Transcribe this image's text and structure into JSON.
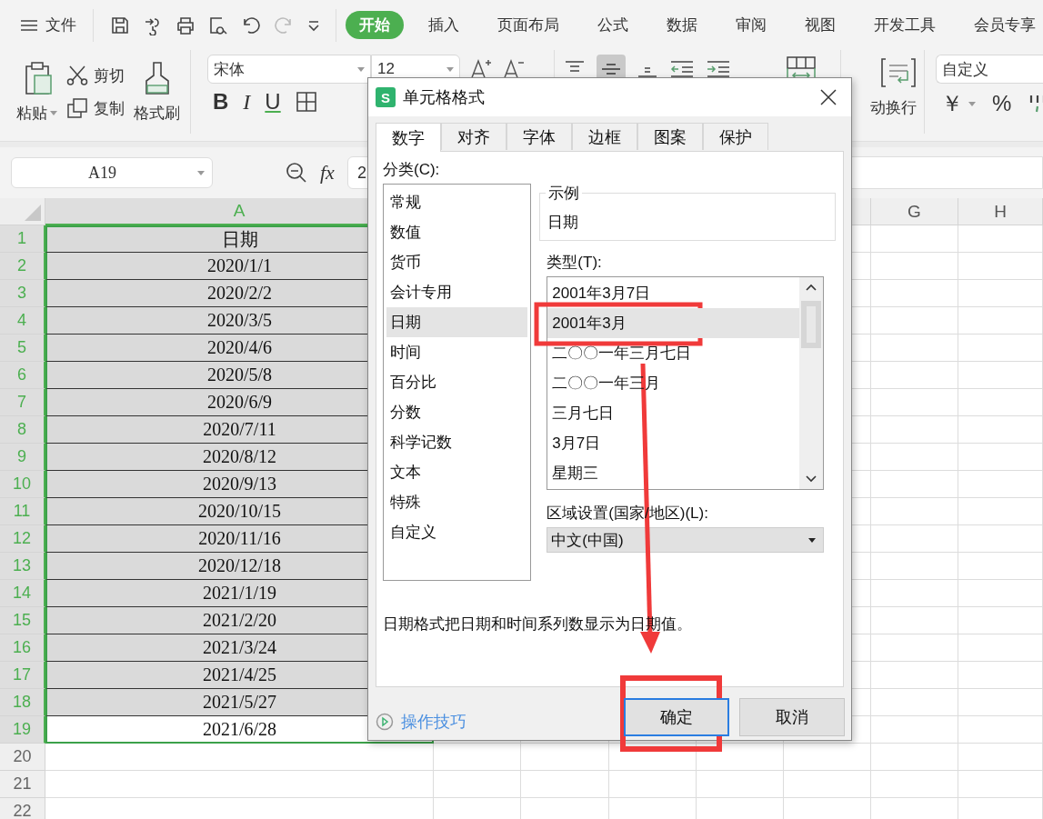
{
  "menu": {
    "file": "文件",
    "tabs": [
      {
        "label": "开始",
        "selected": true
      },
      {
        "label": "插入",
        "selected": false
      },
      {
        "label": "页面布局",
        "selected": false
      },
      {
        "label": "公式",
        "selected": false
      },
      {
        "label": "数据",
        "selected": false
      },
      {
        "label": "审阅",
        "selected": false
      },
      {
        "label": "视图",
        "selected": false
      },
      {
        "label": "开发工具",
        "selected": false
      },
      {
        "label": "会员专享",
        "selected": false
      }
    ]
  },
  "ribbon": {
    "paste": "粘贴",
    "cut": "剪切",
    "copy": "复制",
    "format_painter": "格式刷",
    "font": "宋体",
    "font_size": "12",
    "styles": [
      "B",
      "I",
      "U"
    ],
    "wrap_text": "动换行",
    "number_format": "自定义",
    "currency": "￥",
    "percent": "%"
  },
  "formula_bar": {
    "name_box": "A19",
    "fx": "fx",
    "value": "2"
  },
  "columns": [
    {
      "label": "A",
      "selected": true
    },
    {
      "label": "G",
      "selected": false
    },
    {
      "label": "H",
      "selected": false
    }
  ],
  "rows": [
    {
      "num": "1",
      "value": "日期",
      "selected": true,
      "active": false
    },
    {
      "num": "2",
      "value": "2020/1/1",
      "selected": true,
      "active": false
    },
    {
      "num": "3",
      "value": "2020/2/2",
      "selected": true,
      "active": false
    },
    {
      "num": "4",
      "value": "2020/3/5",
      "selected": true,
      "active": false
    },
    {
      "num": "5",
      "value": "2020/4/6",
      "selected": true,
      "active": false
    },
    {
      "num": "6",
      "value": "2020/5/8",
      "selected": true,
      "active": false
    },
    {
      "num": "7",
      "value": "2020/6/9",
      "selected": true,
      "active": false
    },
    {
      "num": "8",
      "value": "2020/7/11",
      "selected": true,
      "active": false
    },
    {
      "num": "9",
      "value": "2020/8/12",
      "selected": true,
      "active": false
    },
    {
      "num": "10",
      "value": "2020/9/13",
      "selected": true,
      "active": false
    },
    {
      "num": "11",
      "value": "2020/10/15",
      "selected": true,
      "active": false
    },
    {
      "num": "12",
      "value": "2020/11/16",
      "selected": true,
      "active": false
    },
    {
      "num": "13",
      "value": "2020/12/18",
      "selected": true,
      "active": false
    },
    {
      "num": "14",
      "value": "2021/1/19",
      "selected": true,
      "active": false
    },
    {
      "num": "15",
      "value": "2021/2/20",
      "selected": true,
      "active": false
    },
    {
      "num": "16",
      "value": "2021/3/24",
      "selected": true,
      "active": false
    },
    {
      "num": "17",
      "value": "2021/4/25",
      "selected": true,
      "active": false
    },
    {
      "num": "18",
      "value": "2021/5/27",
      "selected": true,
      "active": false
    },
    {
      "num": "19",
      "value": "2021/6/28",
      "selected": true,
      "active": true
    },
    {
      "num": "20",
      "selected": false,
      "active": false
    },
    {
      "num": "21",
      "selected": false,
      "active": false
    },
    {
      "num": "22",
      "selected": false,
      "active": false
    }
  ],
  "dialog": {
    "app_icon": "S",
    "title": "单元格格式",
    "tabs": [
      {
        "label": "数字",
        "selected": true
      },
      {
        "label": "对齐",
        "selected": false
      },
      {
        "label": "字体",
        "selected": false
      },
      {
        "label": "边框",
        "selected": false
      },
      {
        "label": "图案",
        "selected": false
      },
      {
        "label": "保护",
        "selected": false
      }
    ],
    "category_label": "分类(C):",
    "categories": [
      {
        "label": "常规",
        "selected": false
      },
      {
        "label": "数值",
        "selected": false
      },
      {
        "label": "货币",
        "selected": false
      },
      {
        "label": "会计专用",
        "selected": false
      },
      {
        "label": "日期",
        "selected": true
      },
      {
        "label": "时间",
        "selected": false
      },
      {
        "label": "百分比",
        "selected": false
      },
      {
        "label": "分数",
        "selected": false
      },
      {
        "label": "科学记数",
        "selected": false
      },
      {
        "label": "文本",
        "selected": false
      },
      {
        "label": "特殊",
        "selected": false
      },
      {
        "label": "自定义",
        "selected": false
      }
    ],
    "sample": {
      "label": "示例",
      "value": "日期"
    },
    "type_label": "类型(T):",
    "types": [
      {
        "label": "2001年3月7日",
        "selected": false
      },
      {
        "label": "2001年3月",
        "selected": true
      },
      {
        "label": "二〇〇一年三月七日",
        "selected": false
      },
      {
        "label": "二〇〇一年三月",
        "selected": false
      },
      {
        "label": "三月七日",
        "selected": false
      },
      {
        "label": "3月7日",
        "selected": false
      },
      {
        "label": "星期三",
        "selected": false
      }
    ],
    "locale_label": "区域设置(国家/地区)(L):",
    "locale": "中文(中国)",
    "description": "日期格式把日期和时间系列数显示为日期值。",
    "tips": "操作技巧",
    "buttons": [
      {
        "label": "确定",
        "kind": "primary"
      },
      {
        "label": "取消",
        "kind": "normal"
      }
    ]
  }
}
